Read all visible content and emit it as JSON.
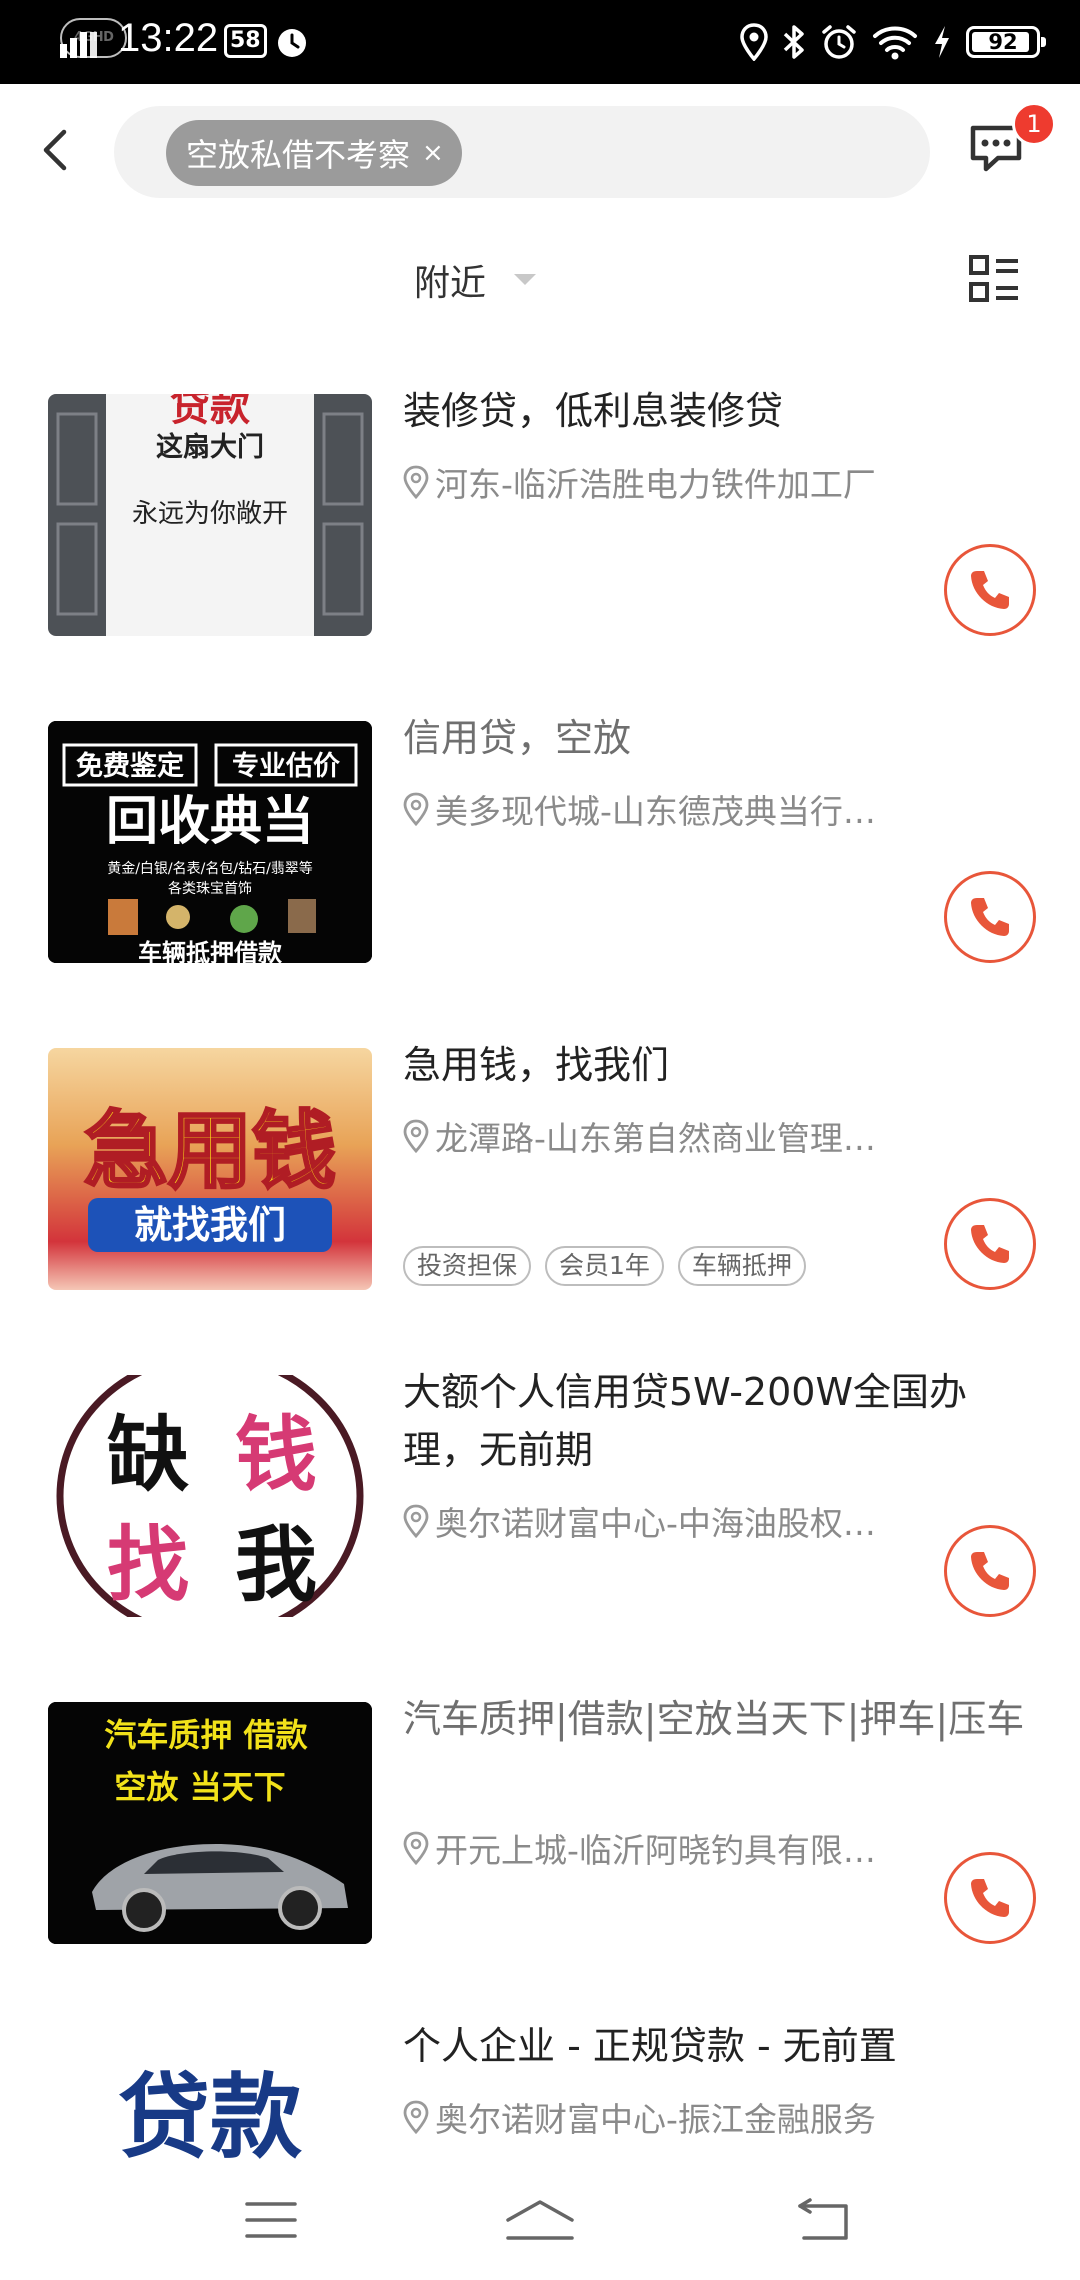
{
  "status_bar": {
    "network": "4GHD",
    "time": "13:22",
    "box_badge": "58",
    "battery": "92",
    "battery_level": 0.92
  },
  "header": {
    "search_chip": "空放私借不考察",
    "chip_close": "×",
    "message_badge": "1"
  },
  "filter": {
    "nearby": "附近"
  },
  "listings": [
    {
      "title": "装修贷，低利息装修贷",
      "location": "河东-临沂浩胜电力铁件加工厂",
      "thumb_lines": [
        "贷款",
        "这扇大门",
        "永远为你敞开"
      ],
      "tags": []
    },
    {
      "title": "信用贷，空放",
      "location": "美多现代城-山东德茂典当行…",
      "thumb_lines": [
        "免费鉴定",
        "专业估价",
        "回收典当",
        "黄金/白银/名表/名包/钻石/翡翠等",
        "各类珠宝首饰",
        "车辆抵押借款"
      ],
      "tags": []
    },
    {
      "title": "急用钱，找我们",
      "location": "龙潭路-山东第自然商业管理…",
      "thumb_lines": [
        "急用钱",
        "就找我们"
      ],
      "tags": [
        "投资担保",
        "会员1年",
        "车辆抵押"
      ]
    },
    {
      "title": "大额个人信用贷5W-200W全国办理，无前期",
      "location": "奥尔诺财富中心-中海油股权…",
      "thumb_lines": [
        "缺",
        "钱",
        "找",
        "我"
      ],
      "tags": []
    },
    {
      "title": "汽车质押|借款|空放当天下|押车|压车",
      "location": "开元上城-临沂阿晓钓具有限…",
      "thumb_lines": [
        "汽车质押 借款",
        "空放 当天下"
      ],
      "tags": []
    },
    {
      "title": "个人企业 - 正规贷款 - 无前置",
      "location": "奥尔诺财富中心-振江金融服务",
      "thumb_lines": [
        "贷款"
      ],
      "tags": []
    }
  ],
  "colors": {
    "accent": "#e8563a",
    "badge": "#ee3b2f",
    "chip": "#9b9b9b"
  },
  "icons": [
    "back-icon",
    "message-icon",
    "layout-toggle-icon",
    "location-pin-icon",
    "phone-icon",
    "menu-icon",
    "home-icon",
    "return-icon"
  ]
}
